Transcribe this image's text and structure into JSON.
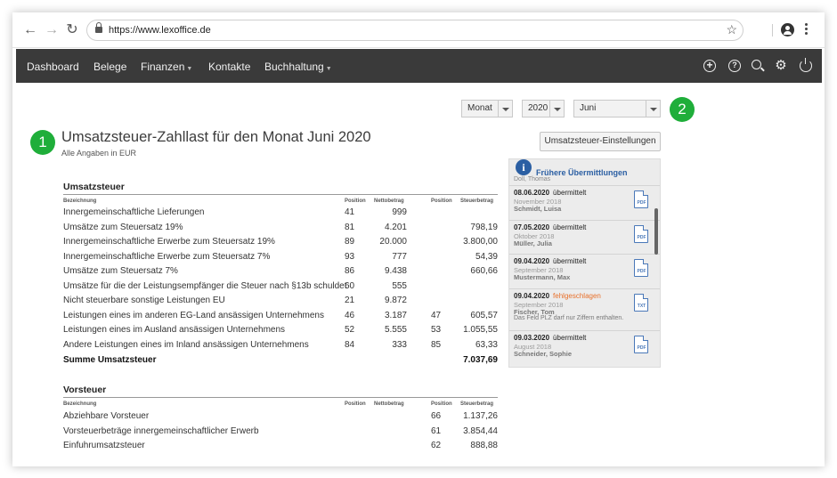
{
  "browser": {
    "url": "https://www.lexoffice.de"
  },
  "menu": {
    "items": [
      {
        "label": "Dashboard"
      },
      {
        "label": "Belege"
      },
      {
        "label": "Finanzen"
      },
      {
        "label": "Kontakte"
      },
      {
        "label": "Buchhaltung"
      }
    ]
  },
  "badges": {
    "one": "1",
    "two": "2"
  },
  "filters": {
    "period_type": "Monat",
    "year": "2020",
    "month": "Juni"
  },
  "page": {
    "title": "Umsatzsteuer-Zahllast für den Monat Juni 2020",
    "subtitle": "Alle Angaben in EUR",
    "settings_button": "Umsatzsteuer-Einstellungen"
  },
  "columns": {
    "bezeichnung": "Bezeichnung",
    "position": "Position",
    "nettobetrag": "Nettobetrag",
    "steuerbetrag": "Steuerbetrag"
  },
  "umsatzsteuer": {
    "title": "Umsatzsteuer",
    "rows": [
      {
        "label": "Innergemeinschaftliche Lieferungen",
        "pos1": "41",
        "netto": "999",
        "pos2": "",
        "steuer": ""
      },
      {
        "label": "Umsätze zum Steuersatz 19%",
        "pos1": "81",
        "netto": "4.201",
        "pos2": "",
        "steuer": "798,19"
      },
      {
        "label": "Innergemeinschaftliche Erwerbe zum Steuersatz 19%",
        "pos1": "89",
        "netto": "20.000",
        "pos2": "",
        "steuer": "3.800,00"
      },
      {
        "label": "Innergemeinschaftliche Erwerbe zum Steuersatz 7%",
        "pos1": "93",
        "netto": "777",
        "pos2": "",
        "steuer": "54,39"
      },
      {
        "label": "Umsätze zum Steuersatz 7%",
        "pos1": "86",
        "netto": "9.438",
        "pos2": "",
        "steuer": "660,66"
      },
      {
        "label": "Umsätze für die der Leistungsempfänger die Steuer nach §13b schuldet",
        "pos1": "60",
        "netto": "555",
        "pos2": "",
        "steuer": ""
      },
      {
        "label": "Nicht steuerbare sonstige Leistungen EU",
        "pos1": "21",
        "netto": "9.872",
        "pos2": "",
        "steuer": ""
      },
      {
        "label": "Leistungen eines im anderen EG-Land ansässigen Unternehmens",
        "pos1": "46",
        "netto": "3.187",
        "pos2": "47",
        "steuer": "605,57"
      },
      {
        "label": "Leistungen eines im Ausland ansässigen Unternehmens",
        "pos1": "52",
        "netto": "5.555",
        "pos2": "53",
        "steuer": "1.055,55"
      },
      {
        "label": "Andere Leistungen eines im Inland ansässigen Unternehmens",
        "pos1": "84",
        "netto": "333",
        "pos2": "85",
        "steuer": "63,33"
      }
    ],
    "sum_label": "Summe Umsatzsteuer",
    "sum_value": "7.037,69"
  },
  "vorsteuer": {
    "title": "Vorsteuer",
    "rows": [
      {
        "label": "Abziehbare Vorsteuer",
        "pos2": "66",
        "steuer": "1.137,26"
      },
      {
        "label": "Vorsteuerbeträge innergemeinschaftlicher Erwerb",
        "pos2": "61",
        "steuer": "3.854,44"
      },
      {
        "label": "Einfuhrumsatzsteuer",
        "pos2": "62",
        "steuer": "888,88"
      }
    ]
  },
  "panel": {
    "title": "Frühere Übermittlungen",
    "cut_text": "Doll, Thomas",
    "entries": [
      {
        "date": "08.06.2020",
        "status": "übermittelt",
        "month": "November 2018",
        "name": "Schmidt, Luisa",
        "file": "PDF",
        "error": ""
      },
      {
        "date": "07.05.2020",
        "status": "übermittelt",
        "month": "Oktober 2018",
        "name": "Müller, Julia",
        "file": "PDF",
        "error": ""
      },
      {
        "date": "09.04.2020",
        "status": "übermittelt",
        "month": "September 2018",
        "name": "Mustermann, Max",
        "file": "PDF",
        "error": ""
      },
      {
        "date": "09.04.2020",
        "status": "fehlgeschlagen",
        "month": "September 2018",
        "name": "Fischer, Tom",
        "file": "TXT",
        "error": "Das Feld PLZ darf nur Ziffern enthalten."
      },
      {
        "date": "09.03.2020",
        "status": "übermittelt",
        "month": "August 2018",
        "name": "Schneider, Sophie",
        "file": "PDF",
        "error": ""
      }
    ]
  },
  "colors": {
    "badge": "#1fae3a",
    "appbar": "#3a3a3a",
    "accent_blue": "#2b5fa3",
    "failed": "#e8702a"
  },
  "icons": [
    "back-arrow-icon",
    "forward-arrow-icon",
    "reload-icon",
    "lock-icon",
    "star-icon",
    "account-icon",
    "kebab-menu-icon",
    "plus-circle-icon",
    "help-icon",
    "search-icon",
    "gear-icon",
    "power-icon",
    "info-icon",
    "pdf-file-icon",
    "txt-file-icon"
  ]
}
